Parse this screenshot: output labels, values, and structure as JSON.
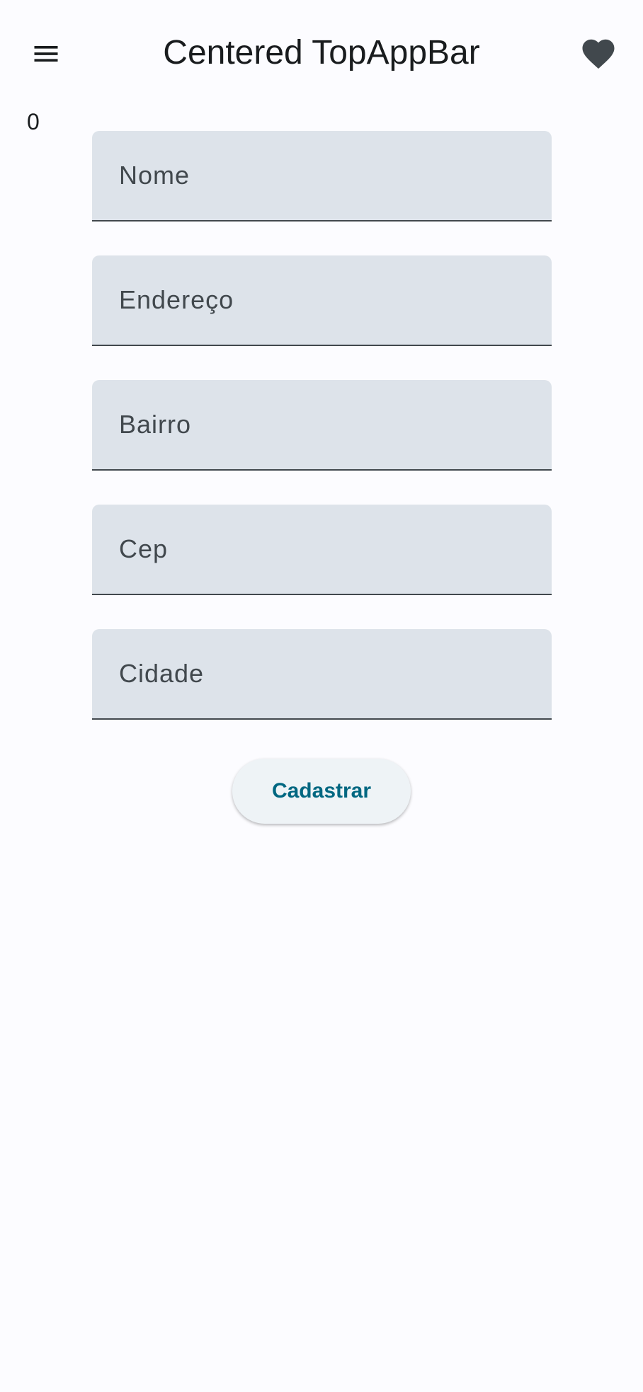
{
  "top_app_bar": {
    "title": "Centered TopAppBar",
    "navigation_icon": "menu-icon",
    "action_icon": "favorite-icon"
  },
  "counter": "0",
  "form": {
    "fields": [
      {
        "label": "Nome",
        "value": ""
      },
      {
        "label": "Endereço",
        "value": ""
      },
      {
        "label": "Bairro",
        "value": ""
      },
      {
        "label": "Cep",
        "value": ""
      },
      {
        "label": "Cidade",
        "value": ""
      }
    ],
    "submit_label": "Cadastrar"
  },
  "colors": {
    "background": "#fcfcff",
    "field_container": "#dde3ea",
    "field_indicator": "#41484d",
    "on_surface": "#191c1e",
    "primary": "#006781",
    "icon": "#41484d"
  }
}
